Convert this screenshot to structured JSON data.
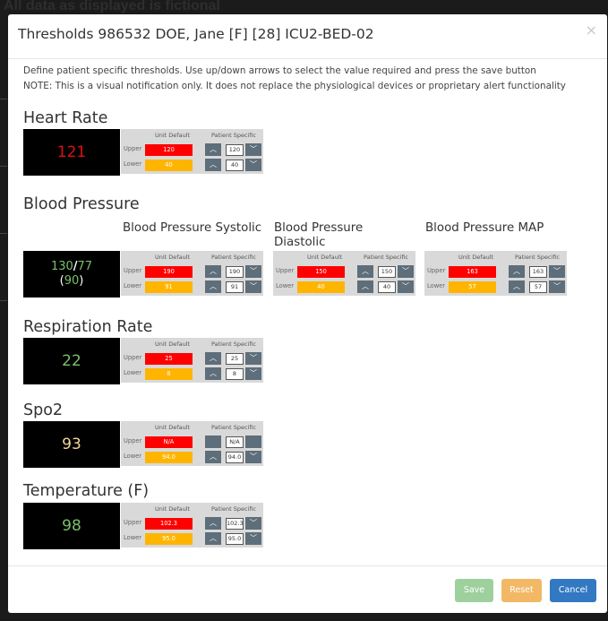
{
  "background": {
    "text": "All data as displayed is fictional"
  },
  "modal": {
    "title": "Thresholds 986532 DOE, Jane [F] [28] ICU2-BED-02",
    "close_icon": "×",
    "intro_line1": "Define patient specific thresholds. Use up/down arrows to select the value required and press the save button",
    "intro_line2": "NOTE: This is a visual notification only. It does not replace the physiological devices or proprietary alert functionality"
  },
  "labels": {
    "unit_default": "Unit Default",
    "patient_specific": "Patient Specific",
    "upper": "Upper",
    "lower": "Lower"
  },
  "heart_rate": {
    "title": "Heart Rate",
    "value": "121",
    "value_color": "#e01010",
    "default_upper": "120",
    "default_lower": "40",
    "patient_upper": "120",
    "patient_lower": "40"
  },
  "blood_pressure": {
    "title": "Blood Pressure",
    "systolic_value": "130",
    "separator": "/",
    "diastolic_value": "77",
    "map_value": "90",
    "systolic_color": "#7cbf6a",
    "diastolic_color": "#7cbf6a",
    "map_color": "#7cbf6a",
    "systolic": {
      "title": "Blood Pressure Systolic",
      "default_upper": "190",
      "default_lower": "91",
      "patient_upper": "190",
      "patient_lower": "91"
    },
    "diastolic": {
      "title": "Blood Pressure Diastolic",
      "default_upper": "150",
      "default_lower": "40",
      "patient_upper": "150",
      "patient_lower": "40"
    },
    "map": {
      "title": "Blood Pressure MAP",
      "default_upper": "163",
      "default_lower": "57",
      "patient_upper": "163",
      "patient_lower": "57"
    }
  },
  "respiration_rate": {
    "title": "Respiration Rate",
    "value": "22",
    "value_color": "#7cbf6a",
    "default_upper": "25",
    "default_lower": "8",
    "patient_upper": "25",
    "patient_lower": "8"
  },
  "spo2": {
    "title": "Spo2",
    "value": "93",
    "value_color": "#f2d79a",
    "default_upper": "N/A",
    "default_lower": "94.0",
    "patient_upper": "N/A",
    "patient_lower": "94.0"
  },
  "temperature": {
    "title": "Temperature (F)",
    "value": "98",
    "value_color": "#7cbf6a",
    "default_upper": "102.3",
    "default_lower": "95.0",
    "patient_upper": "102.3",
    "patient_lower": "95.0"
  },
  "footer": {
    "save": "Save",
    "reset": "Reset",
    "cancel": "Cancel"
  },
  "icons": {
    "up": "chevron-up-icon",
    "down": "chevron-down-icon",
    "close": "close-icon"
  }
}
